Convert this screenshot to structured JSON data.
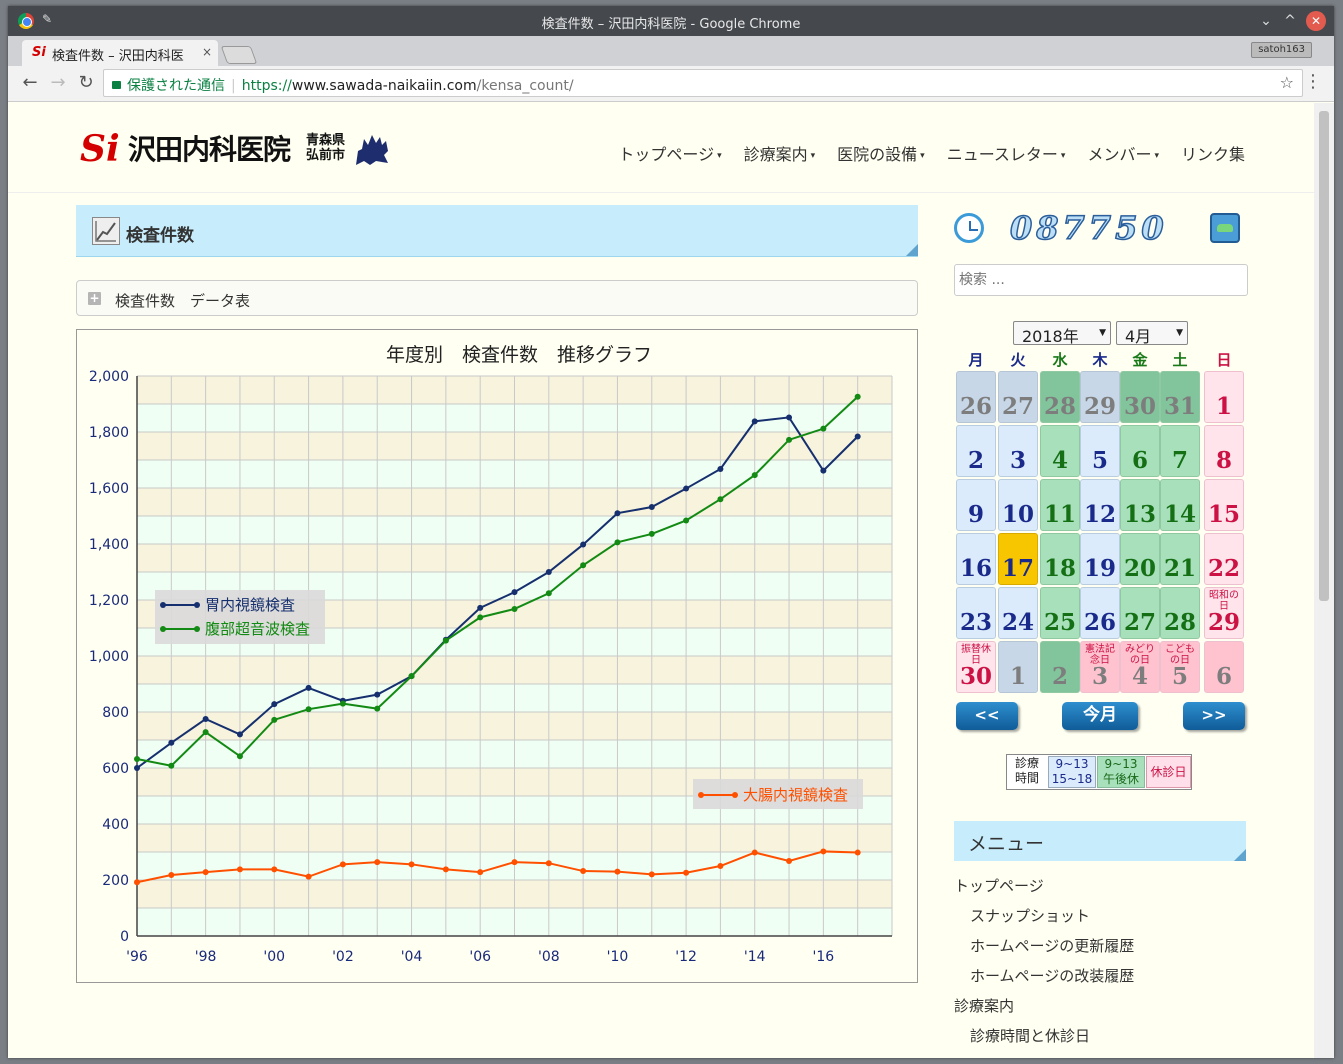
{
  "window": {
    "title": "検査件数 – 沢田内科医院 - Google Chrome"
  },
  "tab": {
    "title": "検査件数 – 沢田内科医",
    "close": "×",
    "favicon": "Si"
  },
  "profile": {
    "name": "satoh163"
  },
  "toolbar": {
    "back": "←",
    "forward": "→",
    "reload": "C",
    "secure_label": "保護された通信",
    "url_scheme": "https://",
    "url_host": "www.sawada-naikaiin.com",
    "url_path": "/kensa_count/",
    "star": "☆",
    "menu": "⋮"
  },
  "site": {
    "logo_mark": "Si",
    "logo_name": "沢田内科医院",
    "logo_pref": "青森県",
    "logo_city": "弘前市",
    "nav": [
      {
        "label": "トップページ",
        "caret": "▾"
      },
      {
        "label": "診療案内",
        "caret": "▾"
      },
      {
        "label": "医院の設備",
        "caret": "▾"
      },
      {
        "label": "ニュースレター",
        "caret": "▾"
      },
      {
        "label": "メンバー",
        "caret": "▾"
      },
      {
        "label": "リンク集",
        "caret": ""
      }
    ]
  },
  "main": {
    "page_title": "検査件数",
    "toggle_icon": "+",
    "toggle_label": "検査件数　データ表"
  },
  "chart_data": {
    "type": "line",
    "title": "年度別　検査件数　推移グラフ",
    "x": [
      1996,
      1997,
      1998,
      1999,
      2000,
      2001,
      2002,
      2003,
      2004,
      2005,
      2006,
      2007,
      2008,
      2009,
      2010,
      2011,
      2012,
      2013,
      2014,
      2015,
      2016,
      2017
    ],
    "x_tick_values": [
      1996,
      1998,
      2000,
      2002,
      2004,
      2006,
      2008,
      2010,
      2012,
      2014,
      2016
    ],
    "x_tick_labels": [
      "'96",
      "'98",
      "'00",
      "'02",
      "'04",
      "'06",
      "'08",
      "'10",
      "'12",
      "'14",
      "'16"
    ],
    "ylim": [
      0,
      2000
    ],
    "y_ticks": [
      0,
      200,
      400,
      600,
      800,
      1000,
      1200,
      1400,
      1600,
      1800,
      2000
    ],
    "y_tick_labels": [
      "0",
      "200",
      "400",
      "600",
      "800",
      "1,000",
      "1,200",
      "1,400",
      "1,600",
      "1,800",
      "2,000"
    ],
    "grid": true,
    "series": [
      {
        "name": "胃内視鏡検査",
        "color": "#162f6e",
        "values": [
          600,
          690,
          775,
          720,
          828,
          886,
          840,
          862,
          928,
          1058,
          1172,
          1228,
          1300,
          1398,
          1510,
          1532,
          1598,
          1668,
          1838,
          1852,
          1662,
          1784
        ]
      },
      {
        "name": "腹部超音波検査",
        "color": "#138a13",
        "values": [
          632,
          608,
          728,
          642,
          772,
          810,
          830,
          812,
          928,
          1055,
          1138,
          1168,
          1224,
          1324,
          1406,
          1436,
          1484,
          1560,
          1646,
          1772,
          1812,
          1926
        ]
      },
      {
        "name": "大腸内視鏡検査",
        "color": "#ff5000",
        "values": [
          192,
          218,
          228,
          238,
          238,
          212,
          256,
          264,
          256,
          238,
          228,
          264,
          260,
          232,
          230,
          220,
          226,
          250,
          298,
          268,
          302,
          298
        ]
      }
    ],
    "legend": [
      {
        "placement": "left-middle",
        "entries": [
          "胃内視鏡検査",
          "腹部超音波検査"
        ]
      },
      {
        "placement": "right-lower",
        "entries": [
          "大腸内視鏡検査"
        ]
      }
    ]
  },
  "sidebar": {
    "counter": "087750",
    "search_placeholder": "検索 ...",
    "calendar": {
      "year_label": "2018年",
      "month_label": "4月",
      "dows": [
        "月",
        "火",
        "水",
        "木",
        "金",
        "土",
        "日"
      ],
      "dow_colors": [
        "#1a2a8a",
        "#1a2a8a",
        "#1a7a1a",
        "#1a2a8a",
        "#1a7a1a",
        "#1a7a1a",
        "#cc1144"
      ],
      "cells": [
        {
          "n": "26",
          "t": "mo",
          "other": true
        },
        {
          "n": "27",
          "t": "mo",
          "other": true
        },
        {
          "n": "28",
          "t": "am",
          "other": true
        },
        {
          "n": "29",
          "t": "mo",
          "other": true
        },
        {
          "n": "30",
          "t": "am",
          "other": true
        },
        {
          "n": "31",
          "t": "am",
          "other": true
        },
        {
          "n": "1",
          "t": "hol"
        },
        {
          "n": "2",
          "t": "wd"
        },
        {
          "n": "3",
          "t": "wd"
        },
        {
          "n": "4",
          "t": "am"
        },
        {
          "n": "5",
          "t": "wd"
        },
        {
          "n": "6",
          "t": "am"
        },
        {
          "n": "7",
          "t": "am"
        },
        {
          "n": "8",
          "t": "hol"
        },
        {
          "n": "9",
          "t": "wd"
        },
        {
          "n": "10",
          "t": "wd"
        },
        {
          "n": "11",
          "t": "am"
        },
        {
          "n": "12",
          "t": "wd"
        },
        {
          "n": "13",
          "t": "am"
        },
        {
          "n": "14",
          "t": "am"
        },
        {
          "n": "15",
          "t": "hol"
        },
        {
          "n": "16",
          "t": "wd"
        },
        {
          "n": "17",
          "t": "today"
        },
        {
          "n": "18",
          "t": "am"
        },
        {
          "n": "19",
          "t": "wd"
        },
        {
          "n": "20",
          "t": "am"
        },
        {
          "n": "21",
          "t": "am"
        },
        {
          "n": "22",
          "t": "hol"
        },
        {
          "n": "23",
          "t": "wd"
        },
        {
          "n": "24",
          "t": "wd"
        },
        {
          "n": "25",
          "t": "am"
        },
        {
          "n": "26",
          "t": "wd"
        },
        {
          "n": "27",
          "t": "am"
        },
        {
          "n": "28",
          "t": "am"
        },
        {
          "n": "29",
          "t": "hol",
          "label": "昭和の日"
        },
        {
          "n": "30",
          "t": "hol",
          "label": "振替休日"
        },
        {
          "n": "1",
          "t": "mo",
          "other": true
        },
        {
          "n": "2",
          "t": "am",
          "other": true
        },
        {
          "n": "3",
          "t": "hol",
          "other": true,
          "label": "憲法記念日"
        },
        {
          "n": "4",
          "t": "hol",
          "other": true,
          "label": "みどりの日"
        },
        {
          "n": "5",
          "t": "hol",
          "other": true,
          "label": "こどもの日"
        },
        {
          "n": "6",
          "t": "hol",
          "other": true
        }
      ],
      "prev_label": "<<",
      "today_label": "今月",
      "next_label": ">>"
    },
    "hours_legend": {
      "label_line1": "診療",
      "label_line2": "時間",
      "weekday_line1": "9~13",
      "weekday_line2": "15~18",
      "am_line1": "9~13",
      "am_line2": "午後休",
      "holiday": "休診日"
    },
    "menu_title": "メニュー",
    "menu_items": [
      {
        "label": "トップページ",
        "indent": false
      },
      {
        "label": "スナップショット",
        "indent": true
      },
      {
        "label": "ホームページの更新履歴",
        "indent": true
      },
      {
        "label": "ホームページの改装履歴",
        "indent": true
      },
      {
        "label": "診療案内",
        "indent": false
      },
      {
        "label": "診療時間と休診日",
        "indent": true
      }
    ]
  }
}
